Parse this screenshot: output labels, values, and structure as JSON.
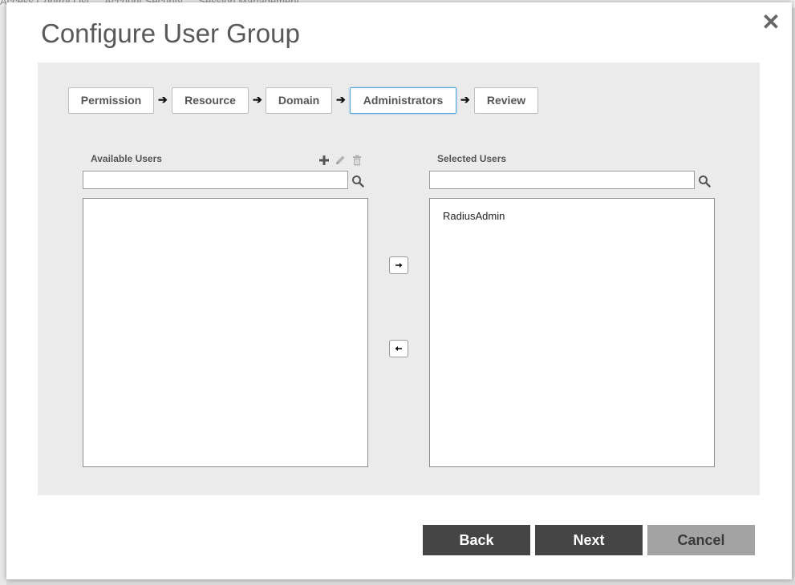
{
  "background": {
    "tabs": [
      "Access Control List",
      "Account Security",
      "Session Management"
    ]
  },
  "dialog": {
    "title": "Configure User Group",
    "close_icon": "close-icon"
  },
  "wizard": {
    "steps": [
      {
        "label": "Permission"
      },
      {
        "label": "Resource"
      },
      {
        "label": "Domain"
      },
      {
        "label": "Administrators",
        "active": true
      },
      {
        "label": "Review"
      }
    ],
    "arrow_icon": "arrow-right-icon"
  },
  "available": {
    "label": "Available Users",
    "search_value": "",
    "items": [],
    "tools": [
      "plus-icon",
      "pencil-icon",
      "trash-icon"
    ]
  },
  "selected": {
    "label": "Selected Users",
    "search_value": "",
    "items": [
      "RadiusAdmin"
    ]
  },
  "transfer": {
    "add_icon": "arrow-right-icon",
    "remove_icon": "arrow-left-icon"
  },
  "footer": {
    "back_label": "Back",
    "next_label": "Next",
    "cancel_label": "Cancel"
  },
  "colors": {
    "active_step_border": "#55a8d6",
    "panel_bg": "#ebebeb",
    "primary_button": "#454545",
    "cancel_button": "#a3a3a3"
  }
}
